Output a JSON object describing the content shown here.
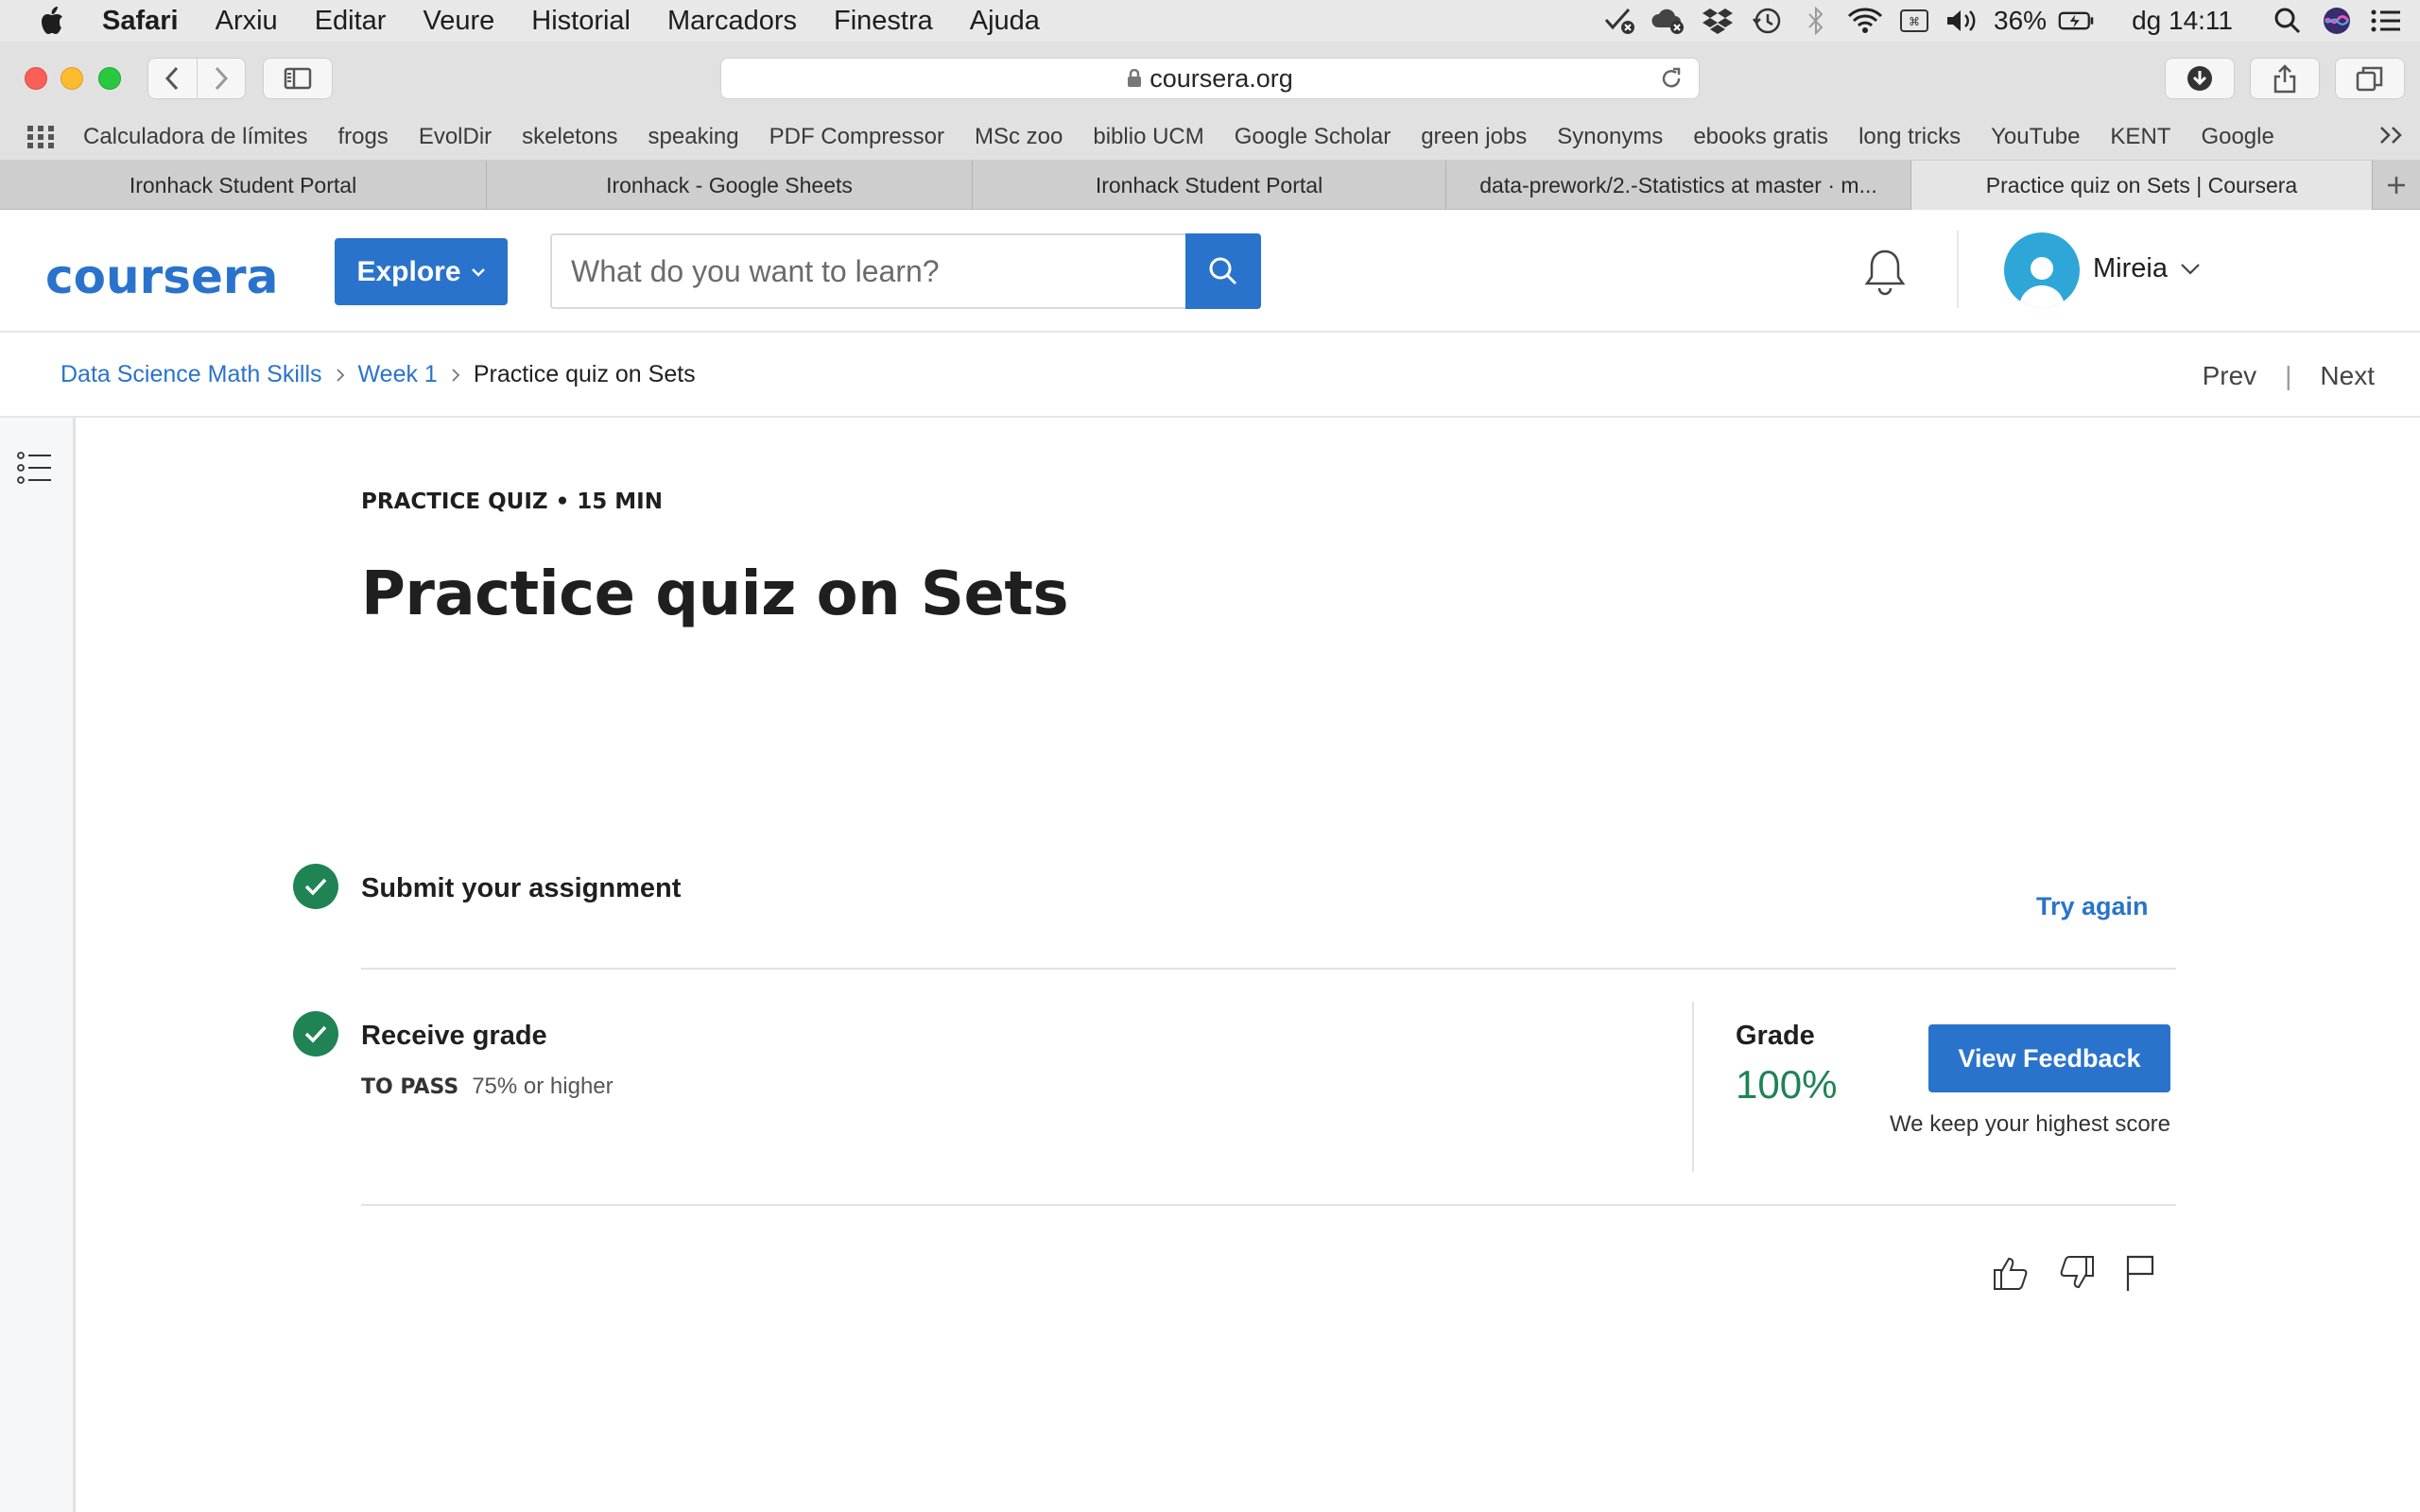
{
  "menubar": {
    "app": "Safari",
    "items": [
      "Arxiu",
      "Editar",
      "Veure",
      "Historial",
      "Marcadors",
      "Finestra",
      "Ajuda"
    ],
    "battery": "36%",
    "clock": "dg 14:11"
  },
  "browser": {
    "url": "coursera.org"
  },
  "bookmarks": [
    "Calculadora de límites",
    "frogs",
    "EvolDir",
    "skeletons",
    "speaking",
    "PDF Compressor",
    "MSc zoo",
    "biblio UCM",
    "Google Scholar",
    "green jobs",
    "Synonyms",
    "ebooks gratis",
    "long tricks",
    "YouTube",
    "KENT",
    "Google"
  ],
  "tabs": [
    {
      "label": "Ironhack Student Portal",
      "active": false
    },
    {
      "label": "Ironhack - Google Sheets",
      "active": false
    },
    {
      "label": "Ironhack Student Portal",
      "active": false
    },
    {
      "label": "data-prework/2.-Statistics at master · m...",
      "active": false
    },
    {
      "label": "Practice quiz on Sets | Coursera",
      "active": true
    }
  ],
  "header": {
    "logo": "coursera",
    "explore_label": "Explore",
    "search_placeholder": "What do you want to learn?",
    "user_name": "Mireia"
  },
  "breadcrumb": {
    "course": "Data Science Math Skills",
    "week": "Week 1",
    "current": "Practice quiz on Sets",
    "prev": "Prev",
    "separator": "|",
    "next": "Next"
  },
  "quiz": {
    "kicker": "PRACTICE QUIZ • 15 MIN",
    "title": "Practice quiz on Sets",
    "submit_step": "Submit your assignment",
    "try_again": "Try again",
    "receive_step": "Receive grade",
    "to_pass_label": "TO PASS",
    "to_pass_value": "75% or higher",
    "grade_label": "Grade",
    "grade_value": "100%",
    "view_feedback": "View Feedback",
    "keep_note": "We keep your highest score"
  },
  "colors": {
    "brand": "#2a73cc",
    "success": "#1f8354"
  }
}
